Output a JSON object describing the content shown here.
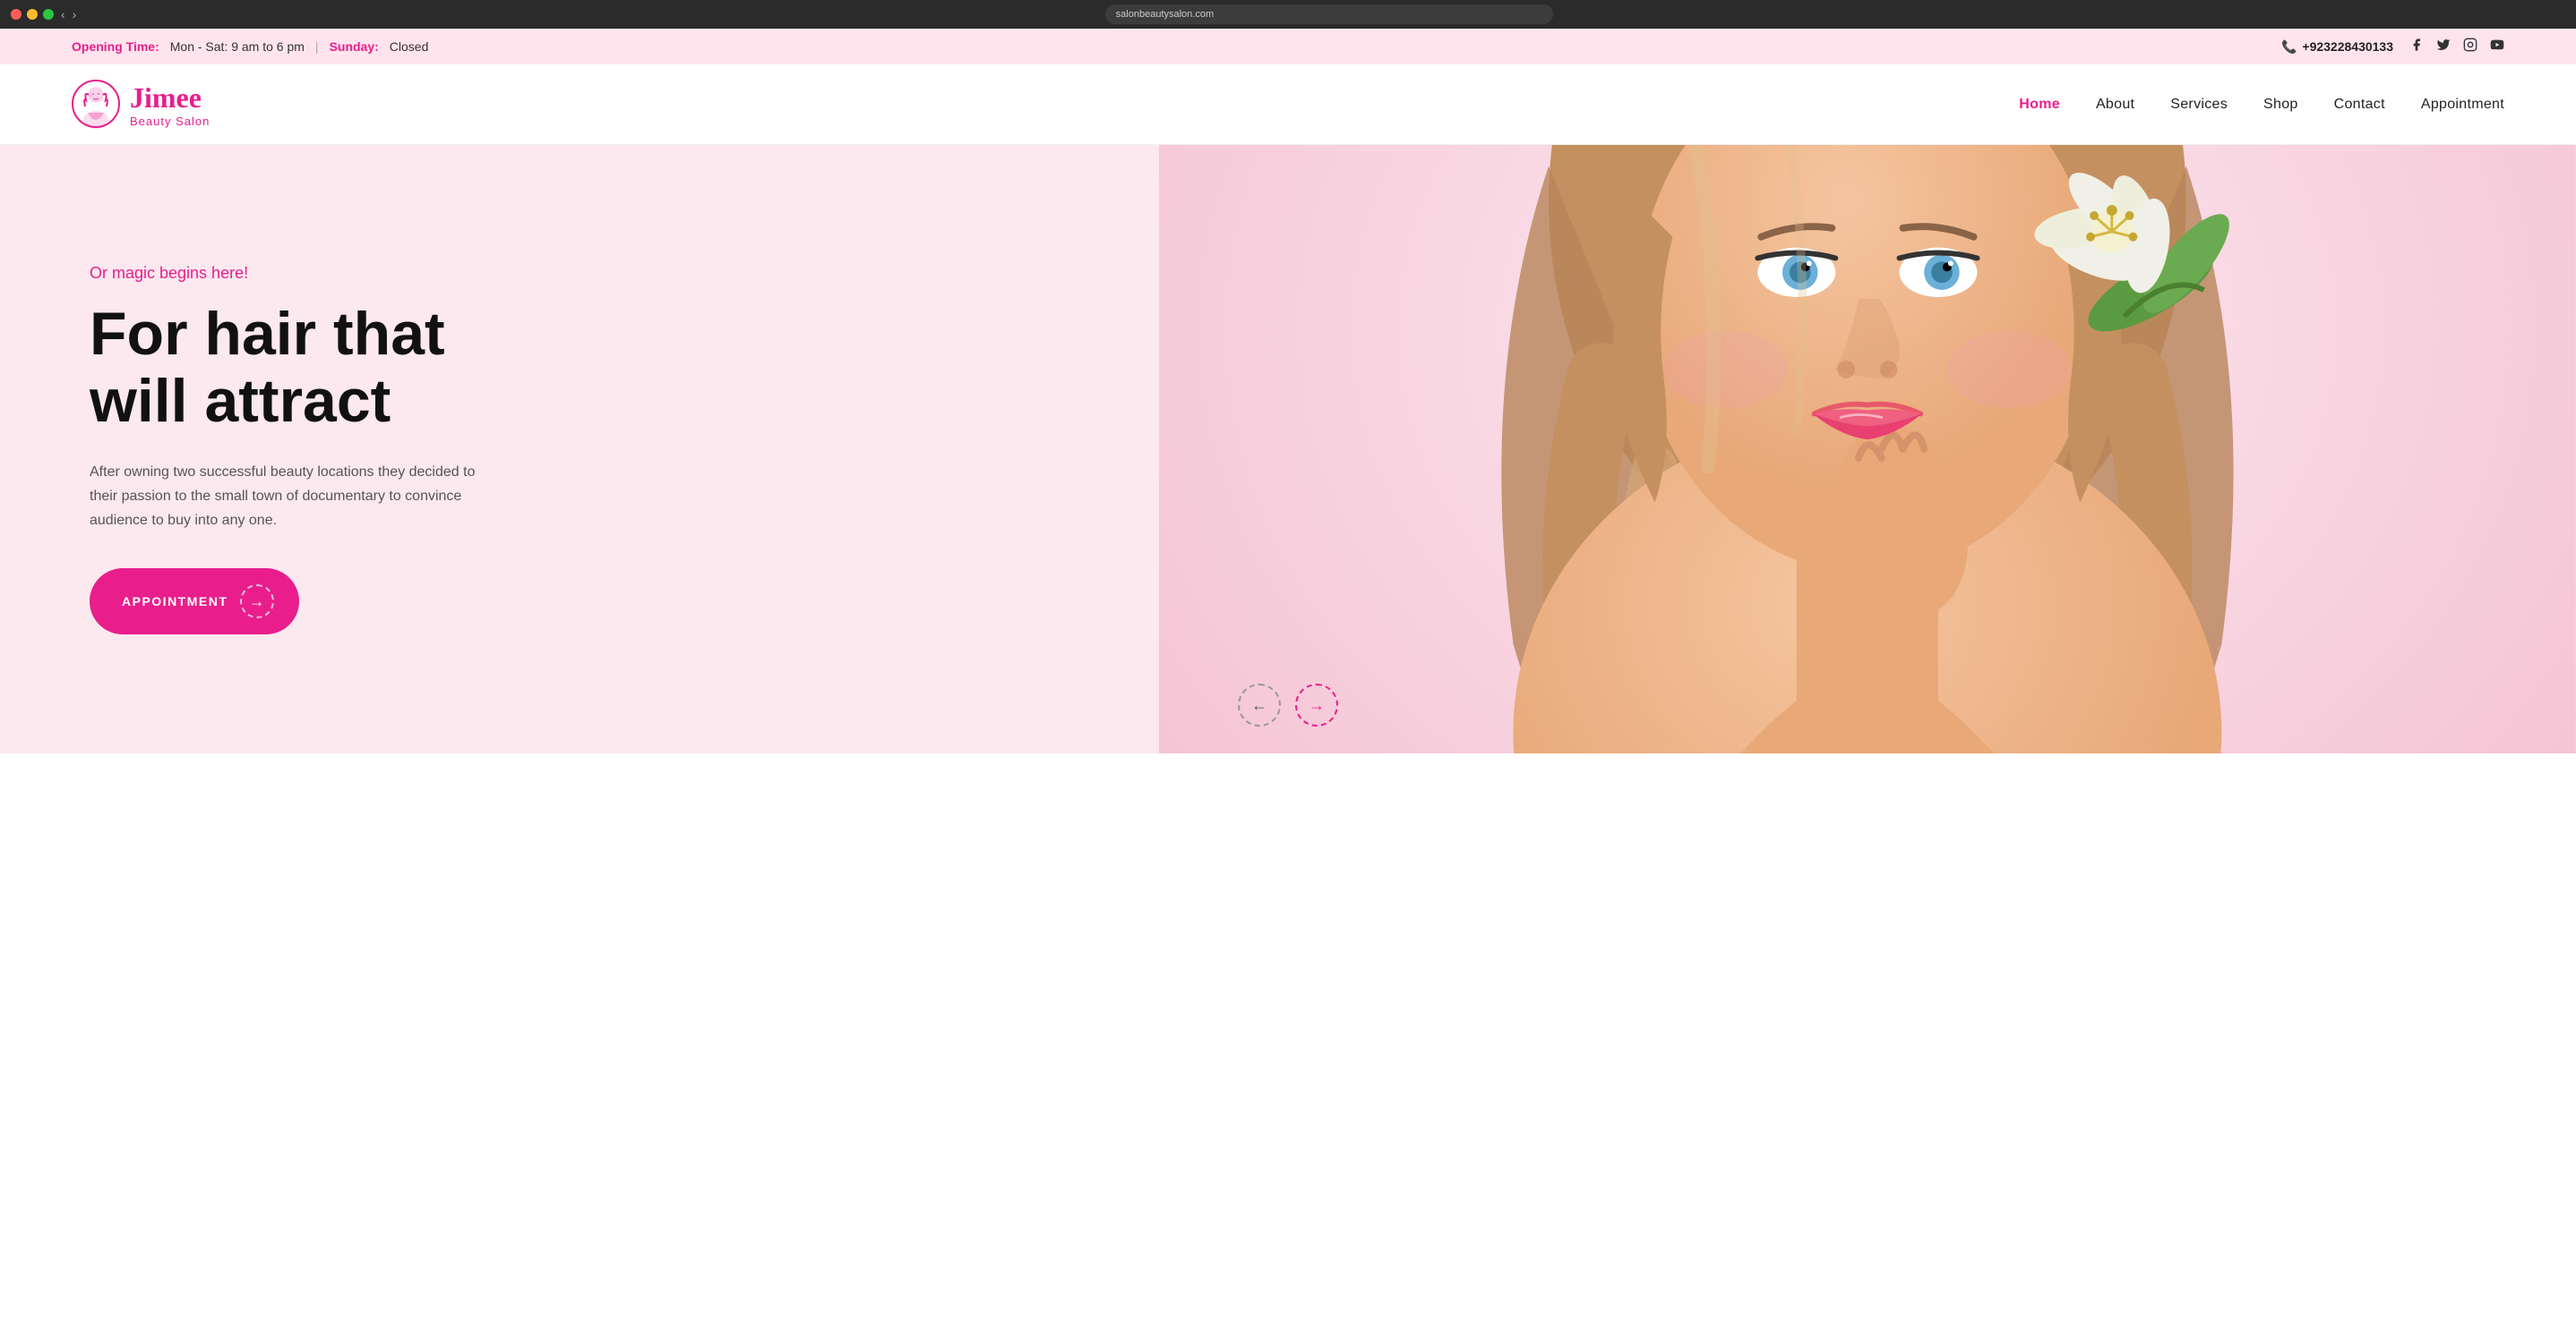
{
  "browser": {
    "address": "salonbeautysalon.com",
    "dots": [
      "red",
      "yellow",
      "green"
    ]
  },
  "topbar": {
    "opening_label": "Opening Time:",
    "opening_hours": "Mon - Sat: 9 am to 6 pm",
    "divider": "|",
    "sunday_label": "Sunday:",
    "sunday_value": "Closed",
    "phone_icon": "📞",
    "phone": "+923228430133",
    "social": [
      {
        "name": "facebook",
        "icon": "f",
        "label": "Facebook"
      },
      {
        "name": "twitter",
        "icon": "𝕏",
        "label": "Twitter"
      },
      {
        "name": "instagram",
        "icon": "◎",
        "label": "Instagram"
      },
      {
        "name": "youtube",
        "icon": "▶",
        "label": "YouTube"
      }
    ]
  },
  "navbar": {
    "logo_name": "Jimee",
    "logo_sub": "Beauty Salon",
    "nav_items": [
      {
        "label": "Home",
        "active": true
      },
      {
        "label": "About",
        "active": false
      },
      {
        "label": "Services",
        "active": false
      },
      {
        "label": "Shop",
        "active": false
      },
      {
        "label": "Contact",
        "active": false
      },
      {
        "label": "Appointment",
        "active": false
      }
    ]
  },
  "hero": {
    "tagline": "Or magic begins here!",
    "title_line1": "For hair that",
    "title_line2": "will attract",
    "description": "After owning two successful beauty locations they decided to their passion to the small town of documentary to convince audience to buy into any one.",
    "btn_label": "APPOINTMENT",
    "btn_arrow": "→"
  },
  "slider": {
    "prev_arrow": "←",
    "next_arrow": "→"
  },
  "colors": {
    "pink": "#e91e8c",
    "light_pink_bg": "#fce8ef",
    "dark": "#111111",
    "text_gray": "#555555"
  }
}
